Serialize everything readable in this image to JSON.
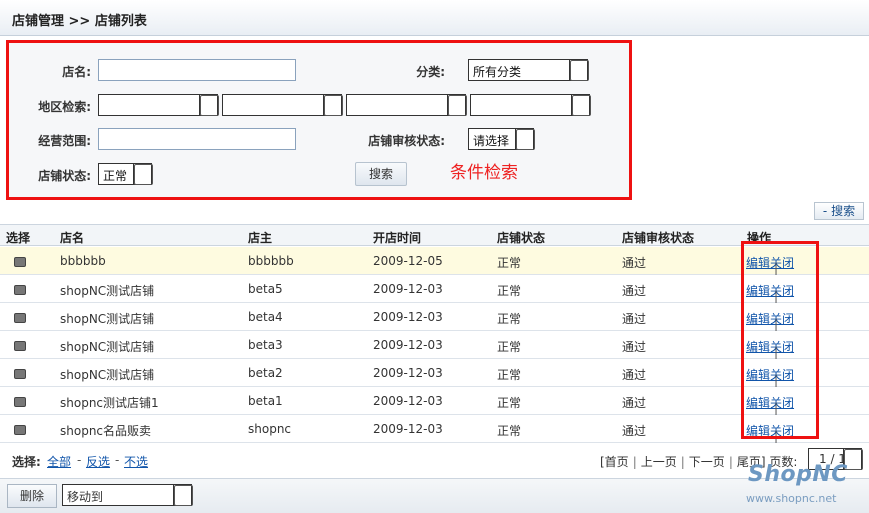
{
  "header": {
    "title": "店铺管理  >> 店铺列表"
  },
  "filter": {
    "shop_name_label": "店名:",
    "category_label": "分类:",
    "category_value": "所有分类",
    "region_label": "地区检索:",
    "scope_label": "经营范围:",
    "audit_label": "店铺审核状态:",
    "audit_value": "请选择",
    "status_label": "店铺状态:",
    "status_value": "正常",
    "search_button": "搜索",
    "annotation": "条件检索"
  },
  "toolbar": {
    "search_toggle": "- 搜索"
  },
  "table": {
    "headers": [
      "选择",
      "店名",
      "店主",
      "开店时间",
      "店铺状态",
      "店铺审核状态",
      "操作"
    ],
    "rows": [
      {
        "name": "bbbbbb",
        "owner": "bbbbbb",
        "date": "2009-12-05",
        "status": "正常",
        "audit": "通过"
      },
      {
        "name": "shopNC测试店铺",
        "owner": "beta5",
        "date": "2009-12-03",
        "status": "正常",
        "audit": "通过"
      },
      {
        "name": "shopNC测试店铺",
        "owner": "beta4",
        "date": "2009-12-03",
        "status": "正常",
        "audit": "通过"
      },
      {
        "name": "shopNC测试店铺",
        "owner": "beta3",
        "date": "2009-12-03",
        "status": "正常",
        "audit": "通过"
      },
      {
        "name": "shopNC测试店铺",
        "owner": "beta2",
        "date": "2009-12-03",
        "status": "正常",
        "audit": "通过"
      },
      {
        "name": "shopnc测试店铺1",
        "owner": "beta1",
        "date": "2009-12-03",
        "status": "正常",
        "audit": "通过"
      },
      {
        "name": "shopnc名品贩卖",
        "owner": "shopnc",
        "date": "2009-12-03",
        "status": "正常",
        "audit": "通过"
      }
    ],
    "edit_label": "编辑",
    "close_label": "关闭",
    "op_separator": "|"
  },
  "footer": {
    "select_label": "选择:",
    "select_all": "全部",
    "select_invert": "反选",
    "select_none": "不选",
    "dash": "-",
    "first": "[首页",
    "prev": "上一页",
    "next": "下一页",
    "last": "尾页]",
    "pages_label": "页数:",
    "page_value": "1 / 1"
  },
  "bottom": {
    "delete_button": "删除",
    "move_value": "移动到"
  },
  "watermark": {
    "logo": "ShopNC",
    "url": "www.shopnc.net"
  },
  "colors": {
    "annotation_red": "#ee1111",
    "link_blue": "#1155aa",
    "highlight_row": "#fefbe0"
  }
}
